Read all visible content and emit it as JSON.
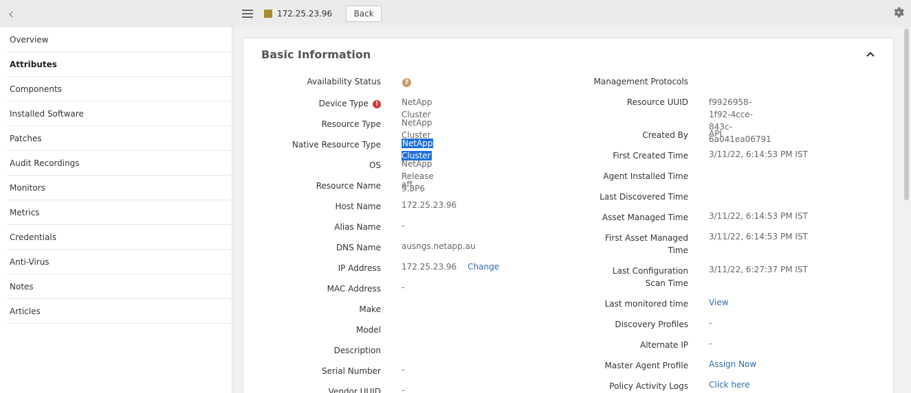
{
  "sidebar": {
    "items": [
      {
        "label": "Overview"
      },
      {
        "label": "Attributes"
      },
      {
        "label": "Components"
      },
      {
        "label": "Installed Software"
      },
      {
        "label": "Patches"
      },
      {
        "label": "Audit Recordings"
      },
      {
        "label": "Monitors"
      },
      {
        "label": "Metrics"
      },
      {
        "label": "Credentials"
      },
      {
        "label": "Anti-Virus"
      },
      {
        "label": "Notes"
      },
      {
        "label": "Articles"
      }
    ],
    "active_index": 1
  },
  "header": {
    "title": "172.25.23.96",
    "back_label": "Back",
    "swatch_color": "#a88b2d"
  },
  "panel": {
    "title": "Basic Information"
  },
  "left_fields": [
    {
      "label": "Availability Status",
      "value": ""
    },
    {
      "label": "Device Type",
      "value": "NetApp Cluster"
    },
    {
      "label": "Resource Type",
      "value": "NetApp Cluster"
    },
    {
      "label": "Native Resource Type",
      "value": "NetApp Cluster"
    },
    {
      "label": "OS",
      "value": "NetApp Release 9.8P6"
    },
    {
      "label": "Resource Name",
      "value": "aff"
    },
    {
      "label": "Host Name",
      "value": "172.25.23.96"
    },
    {
      "label": "Alias Name",
      "value": "-"
    },
    {
      "label": "DNS Name",
      "value": "ausngs.netapp.au"
    },
    {
      "label": "IP Address",
      "value": "172.25.23.96",
      "action": "Change"
    },
    {
      "label": "MAC Address",
      "value": "-"
    },
    {
      "label": "Make",
      "value": ""
    },
    {
      "label": "Model",
      "value": ""
    },
    {
      "label": "Description",
      "value": ""
    },
    {
      "label": "Serial Number",
      "value": "-"
    },
    {
      "label": "Vendor UUID",
      "value": "-"
    }
  ],
  "right_fields": [
    {
      "label": "Management Protocols",
      "value": ""
    },
    {
      "label": "Resource UUID",
      "value_line1": "f9926958-1f92-4cce-843c-",
      "value_line2": "6a041ea06791"
    },
    {
      "label": "Created By",
      "value": "API"
    },
    {
      "label": "First Created Time",
      "value": "3/11/22, 6:14:53 PM IST"
    },
    {
      "label": "Agent Installed Time",
      "value": ""
    },
    {
      "label": "Last Discovered Time",
      "value": ""
    },
    {
      "label": "Asset Managed Time",
      "value": "3/11/22, 6:14:53 PM IST"
    },
    {
      "label_line1": "First Asset Managed",
      "label_line2": "Time",
      "value": "3/11/22, 6:14:53 PM IST"
    },
    {
      "label_line1": "Last Configuration",
      "label_line2": "Scan Time",
      "value": "3/11/22, 6:27:37 PM IST"
    },
    {
      "label": "Last monitored time",
      "value": "View"
    },
    {
      "label": "Discovery Profiles",
      "value": "-"
    },
    {
      "label": "Alternate IP",
      "value": "-"
    },
    {
      "label": "Master Agent Profile",
      "value": "Assign Now"
    },
    {
      "label": "Policy Activity Logs",
      "value": "Click here"
    }
  ],
  "icons": {
    "availability": "?",
    "device_type_alert": "!"
  }
}
